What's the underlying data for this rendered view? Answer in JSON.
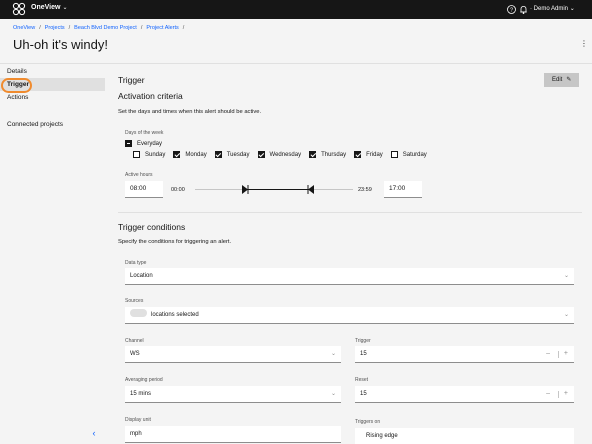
{
  "topbar": {
    "app_name": "OneView",
    "user_name": "Demo Admin"
  },
  "breadcrumb": [
    "OneView",
    "Projects",
    "Beach Blvd Demo Project",
    "Project Alerts"
  ],
  "page": {
    "title": "Uh-oh it's windy!"
  },
  "sidebar": {
    "items": [
      {
        "label": "Details",
        "active": false
      },
      {
        "label": "Trigger",
        "active": true
      },
      {
        "label": "Actions",
        "active": false
      }
    ],
    "connected_projects": "Connected projects"
  },
  "trigger": {
    "title": "Trigger",
    "edit_label": "Edit",
    "activation": {
      "title": "Activation criteria",
      "description": "Set the days and times when this alert should be active.",
      "days_label": "Days of the week",
      "everyday_label": "Everyday",
      "days": [
        {
          "label": "Sunday",
          "checked": false
        },
        {
          "label": "Monday",
          "checked": true
        },
        {
          "label": "Tuesday",
          "checked": true
        },
        {
          "label": "Wednesday",
          "checked": true
        },
        {
          "label": "Thursday",
          "checked": true
        },
        {
          "label": "Friday",
          "checked": true
        },
        {
          "label": "Saturday",
          "checked": false
        }
      ],
      "hours_label": "Active hours",
      "start_time": "08:00",
      "range_min": "00:00",
      "range_max": "23:59",
      "end_time": "17:00"
    },
    "conditions": {
      "title": "Trigger conditions",
      "description": "Specify the conditions for triggering an alert.",
      "data_type_label": "Data type",
      "data_type_value": "Location",
      "sources_label": "Sources",
      "sources_value": "locations selected",
      "channel_label": "Channel",
      "channel_value": "WS",
      "trigger_label": "Trigger",
      "trigger_value": "15",
      "averaging_label": "Averaging period",
      "averaging_value": "15 mins",
      "reset_label": "Reset",
      "reset_value": "15",
      "display_unit_label": "Display unit",
      "display_unit_value": "mph",
      "triggers_on_label": "Triggers on",
      "triggers_on_value": "Rising edge"
    }
  },
  "colors": {
    "topbar_bg": "#161616",
    "link": "#0f62fe",
    "highlight_ring": "#f08b2e",
    "active_item_bg": "#e0e0e0"
  }
}
